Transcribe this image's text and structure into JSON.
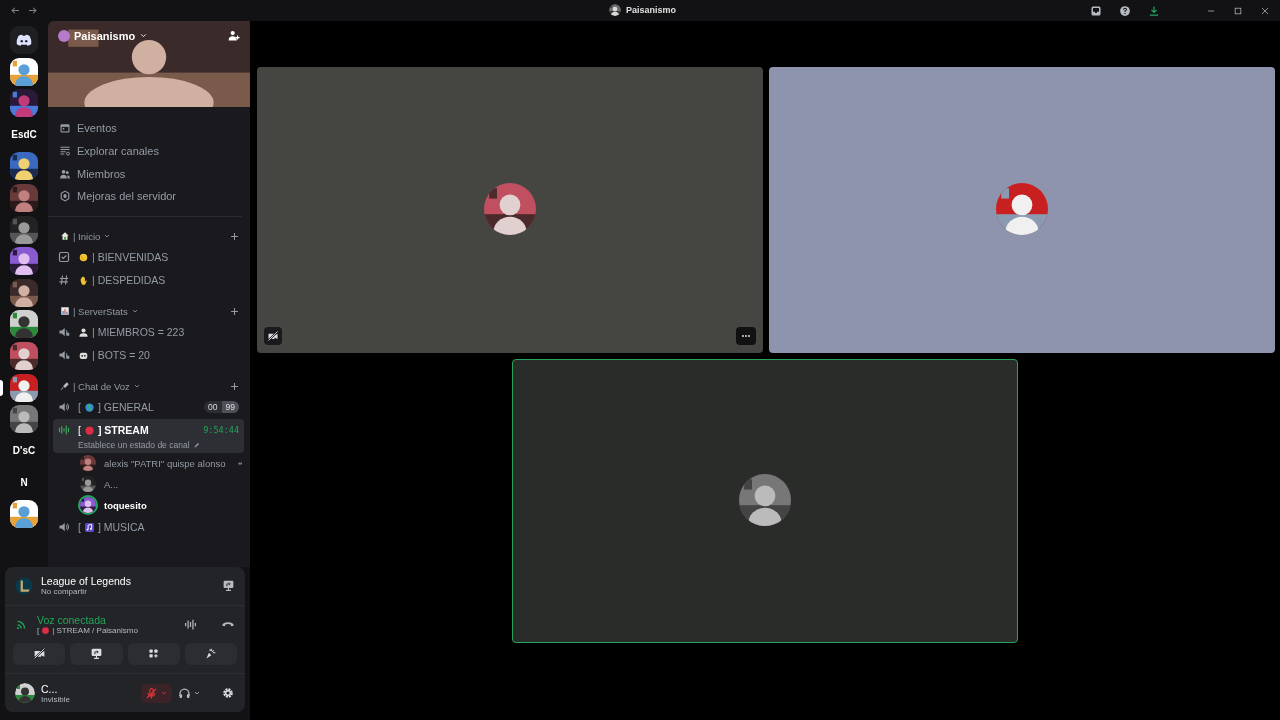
{
  "window": {
    "title": "Paisanismo"
  },
  "server_rail": [
    {
      "kind": "logo",
      "selected": false
    },
    {
      "kind": "picture",
      "selected": false
    },
    {
      "kind": "picture",
      "selected": false
    },
    {
      "kind": "text",
      "label": "EsdC",
      "selected": false
    },
    {
      "kind": "picture",
      "selected": false
    },
    {
      "kind": "picture",
      "selected": false
    },
    {
      "kind": "picture",
      "selected": false
    },
    {
      "kind": "picture",
      "selected": false
    },
    {
      "kind": "picture",
      "selected": false
    },
    {
      "kind": "picture",
      "selected": false
    },
    {
      "kind": "picture",
      "selected": false
    },
    {
      "kind": "picture",
      "selected": true
    },
    {
      "kind": "picture",
      "selected": false
    },
    {
      "kind": "text",
      "label": "D'sC",
      "selected": false
    },
    {
      "kind": "text",
      "label": "N",
      "selected": false
    },
    {
      "kind": "picture",
      "selected": false
    }
  ],
  "server": {
    "name": "Paisanismo"
  },
  "nav_items": [
    {
      "kind": "calendar",
      "label": "Eventos"
    },
    {
      "kind": "browse",
      "label": "Explorar canales"
    },
    {
      "kind": "members",
      "label": "Miembros"
    },
    {
      "kind": "boost",
      "label": "Mejoras del servidor"
    }
  ],
  "categories": [
    {
      "name": "| Inicio",
      "channels": [
        {
          "kind": "rules",
          "name": "| BIENVENIDAS",
          "selected": false
        },
        {
          "kind": "text",
          "name": "| DESPEDIDAS",
          "selected": false
        }
      ]
    },
    {
      "name": "| ServerStats",
      "channels": [
        {
          "kind": "voice-locked",
          "name": "| MIEMBROS = 223",
          "selected": false
        },
        {
          "kind": "voice-locked",
          "name": "| BOTS = 20",
          "selected": false
        }
      ]
    },
    {
      "name": "| Chat de Voz",
      "channels": [
        {
          "kind": "voice",
          "open": "[",
          "name": "] GENERAL",
          "user_count": "00",
          "user_limit": "99",
          "selected": false
        },
        {
          "kind": "voice-live",
          "open": "[",
          "name": "] STREAM",
          "time": "9:54:44",
          "status": "Establece un estado de canal",
          "selected": true,
          "users": [
            {
              "name": "alexis \"PATRI\" quispe alonso",
              "speaking": false,
              "muted": true
            },
            {
              "name": "A...",
              "speaking": false,
              "muted": false
            },
            {
              "name": "toquesito",
              "speaking": true,
              "muted": false
            }
          ]
        },
        {
          "kind": "voice",
          "open": "[",
          "name": "] MUSICA",
          "selected": false
        }
      ]
    }
  ],
  "activity": {
    "game": "League of Legends",
    "sharing": "No compartir"
  },
  "voice": {
    "status": "Voz conectada",
    "open": "[",
    "channel": "| STREAM / Paisanismo"
  },
  "user": {
    "name": "C...",
    "status": "Invisible",
    "mic_muted": true
  },
  "tiles": [
    {
      "color": "#454542",
      "camera_off": true,
      "speaking": false
    },
    {
      "color": "#8e94ae",
      "camera_off": false,
      "speaking": false
    },
    {
      "color": "#2a2c2a",
      "camera_off": false,
      "speaking": true
    }
  ]
}
